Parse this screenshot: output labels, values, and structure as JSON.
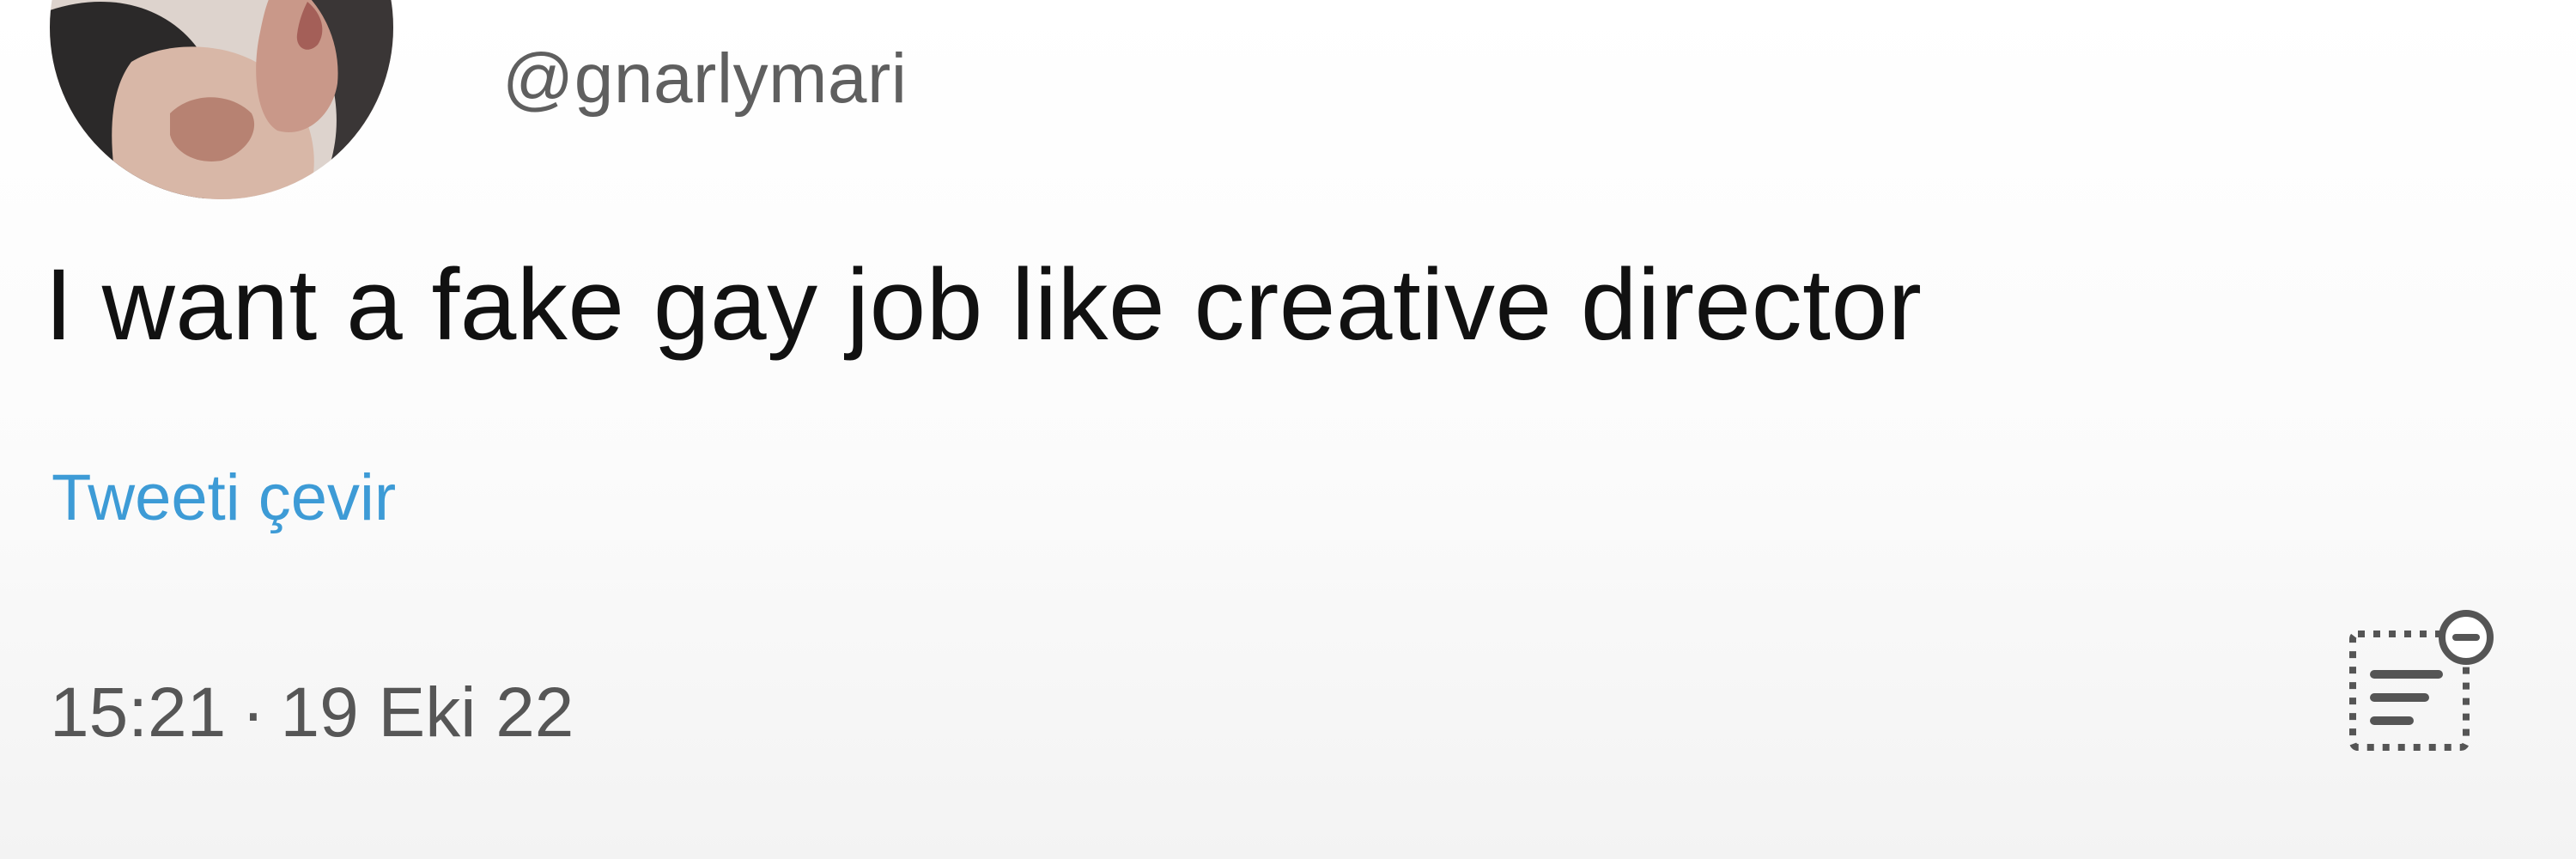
{
  "tweet": {
    "handle": "@gnarlymari",
    "text": "I want a fake gay job like creative director",
    "translate_label": "Tweeti çevir",
    "time": "15:21",
    "separator": "·",
    "date": "19 Eki 22"
  },
  "icons": {
    "avatar": "profile-photo",
    "analytics": "view-analytics-icon"
  },
  "colors": {
    "text": "#111111",
    "secondary_text": "#5f5f5f",
    "link": "#3d9bd6",
    "background": "#ffffff"
  }
}
